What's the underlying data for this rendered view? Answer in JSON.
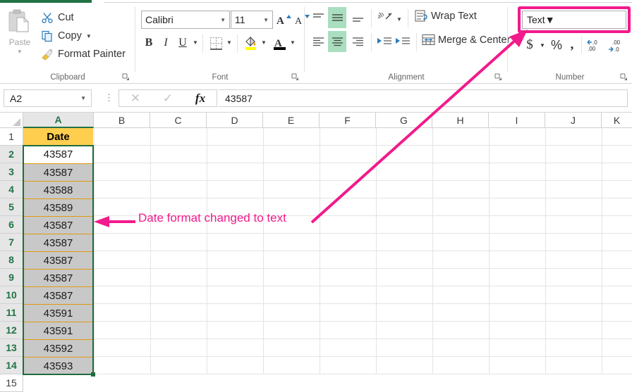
{
  "ribbon": {
    "groups": [
      {
        "label": "Clipboard"
      },
      {
        "label": "Font"
      },
      {
        "label": "Alignment"
      },
      {
        "label": "Number"
      }
    ],
    "clipboard": {
      "paste_label": "Paste",
      "cut_label": "Cut",
      "copy_label": "Copy",
      "format_painter_label": "Format Painter"
    },
    "font": {
      "font_name": "Calibri",
      "font_size": "11",
      "bold_label": "B",
      "italic_label": "I",
      "underline_label": "U",
      "grow_font_label": "A",
      "shrink_font_label": "A",
      "font_color_label": "A"
    },
    "alignment": {
      "wrap_text_label": "Wrap Text",
      "merge_center_label": "Merge & Center"
    },
    "number": {
      "format_value": "Text",
      "accounting_label": "$",
      "percent_label": "%",
      "comma_label": ",",
      "increase_decimal_label": ".00",
      "decrease_decimal_label": ".00"
    }
  },
  "formula_bar": {
    "name_box_value": "A2",
    "cancel_label": "✕",
    "enter_label": "✓",
    "fx_label": "fx",
    "formula_value": "43587"
  },
  "grid": {
    "columns": [
      "A",
      "B",
      "C",
      "D",
      "E",
      "F",
      "G",
      "H",
      "I",
      "J",
      "K"
    ],
    "selected_column": "A",
    "rows": [
      {
        "num": "1",
        "a": "Date",
        "style": "header"
      },
      {
        "num": "2",
        "a": "43587",
        "style": "active"
      },
      {
        "num": "3",
        "a": "43587",
        "style": "selected"
      },
      {
        "num": "4",
        "a": "43588",
        "style": "selected"
      },
      {
        "num": "5",
        "a": "43589",
        "style": "selected"
      },
      {
        "num": "6",
        "a": "43587",
        "style": "selected"
      },
      {
        "num": "7",
        "a": "43587",
        "style": "selected"
      },
      {
        "num": "8",
        "a": "43587",
        "style": "selected"
      },
      {
        "num": "9",
        "a": "43587",
        "style": "selected"
      },
      {
        "num": "10",
        "a": "43587",
        "style": "selected"
      },
      {
        "num": "11",
        "a": "43591",
        "style": "selected"
      },
      {
        "num": "12",
        "a": "43591",
        "style": "selected"
      },
      {
        "num": "13",
        "a": "43592",
        "style": "selected"
      },
      {
        "num": "14",
        "a": "43593",
        "style": "selected"
      },
      {
        "num": "15",
        "a": "",
        "style": "empty"
      }
    ]
  },
  "annotations": {
    "callout_text": "Date format changed to text",
    "accent_color": "#f21a8c"
  },
  "colors": {
    "excel_green": "#217346",
    "selection_border": "#1e6b3c",
    "header_fill": "#ffce4f",
    "selection_fill": "#c8c8c8",
    "cell_border_orange": "#e09b10"
  }
}
